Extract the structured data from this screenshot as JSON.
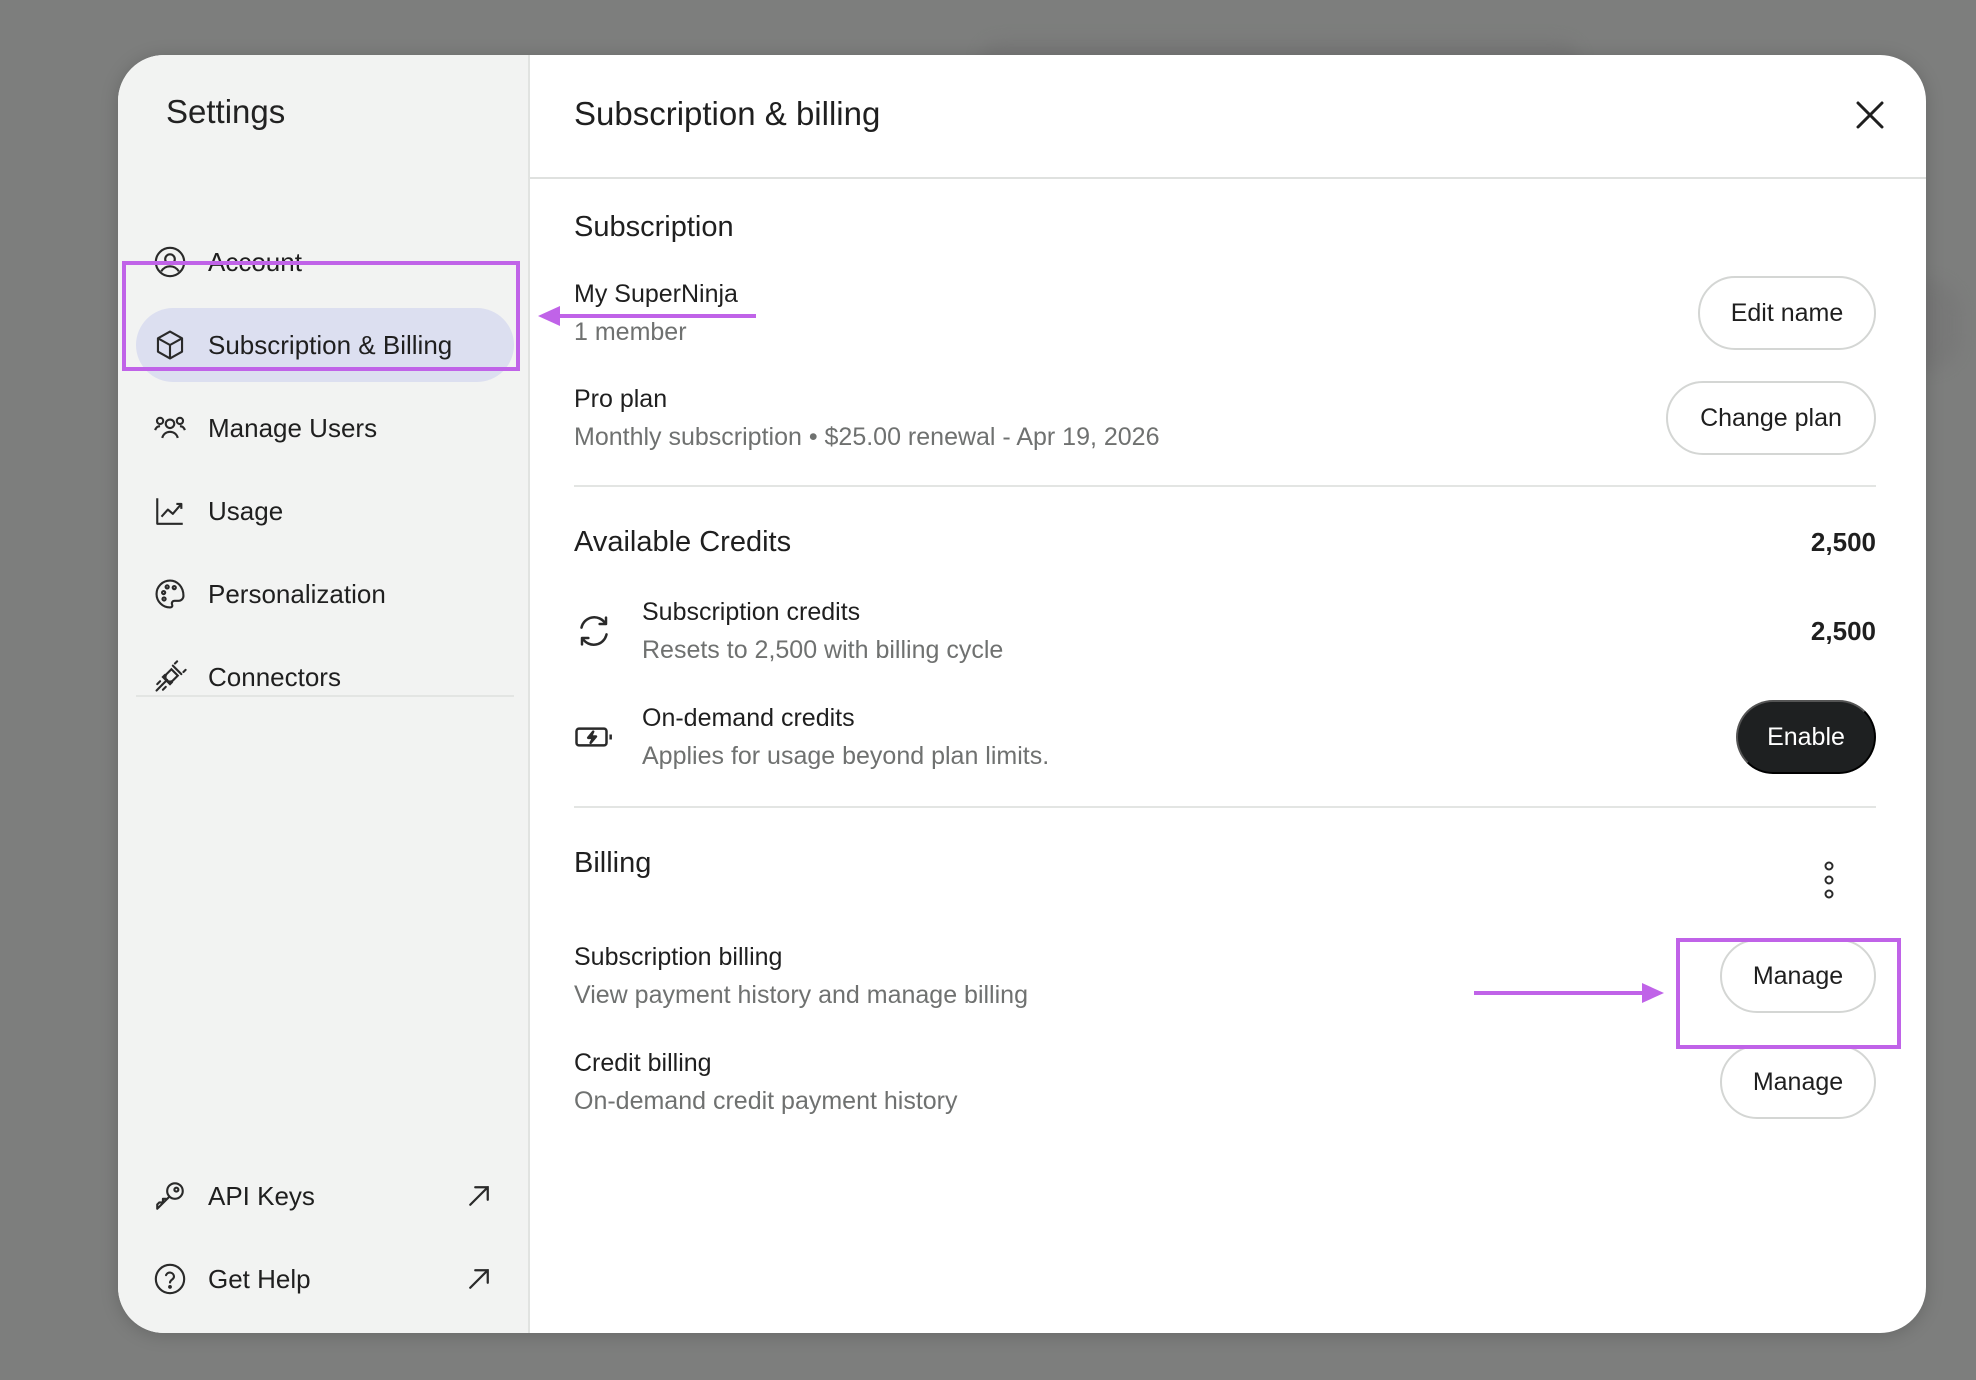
{
  "sidebar": {
    "title": "Settings",
    "items": [
      {
        "label": "Account",
        "icon": "user-circle-icon"
      },
      {
        "label": "Subscription & Billing",
        "icon": "cube-icon",
        "active": true
      },
      {
        "label": "Manage Users",
        "icon": "users-icon"
      },
      {
        "label": "Usage",
        "icon": "chart-line-icon"
      },
      {
        "label": "Personalization",
        "icon": "palette-icon"
      },
      {
        "label": "Connectors",
        "icon": "plug-icon"
      }
    ],
    "bottom": [
      {
        "label": "API Keys",
        "icon": "key-icon"
      },
      {
        "label": "Get Help",
        "icon": "help-circle-icon"
      }
    ]
  },
  "header": {
    "title": "Subscription & billing"
  },
  "subscription": {
    "title": "Subscription",
    "team_name": "My SuperNinja",
    "members": "1 member",
    "edit_name_label": "Edit name",
    "plan_name": "Pro plan",
    "plan_details": "Monthly subscription • $25.00 renewal - Apr 19, 2026",
    "change_plan_label": "Change plan"
  },
  "credits": {
    "title": "Available Credits",
    "total": "2,500",
    "subscription_title": "Subscription credits",
    "subscription_desc": "Resets to 2,500 with billing cycle",
    "subscription_value": "2,500",
    "on_demand_title": "On-demand credits",
    "on_demand_desc": "Applies for usage beyond plan limits.",
    "enable_label": "Enable"
  },
  "billing": {
    "title": "Billing",
    "subscription_title": "Subscription billing",
    "subscription_desc": "View payment history and manage billing",
    "manage_label": "Manage",
    "credit_title": "Credit billing",
    "credit_desc": "On-demand credit payment history",
    "credit_manage_label": "Manage"
  },
  "colors": {
    "accent_annotation": "#c063e8",
    "active_nav": "#dcdff0",
    "dark_button": "#1e2021"
  }
}
